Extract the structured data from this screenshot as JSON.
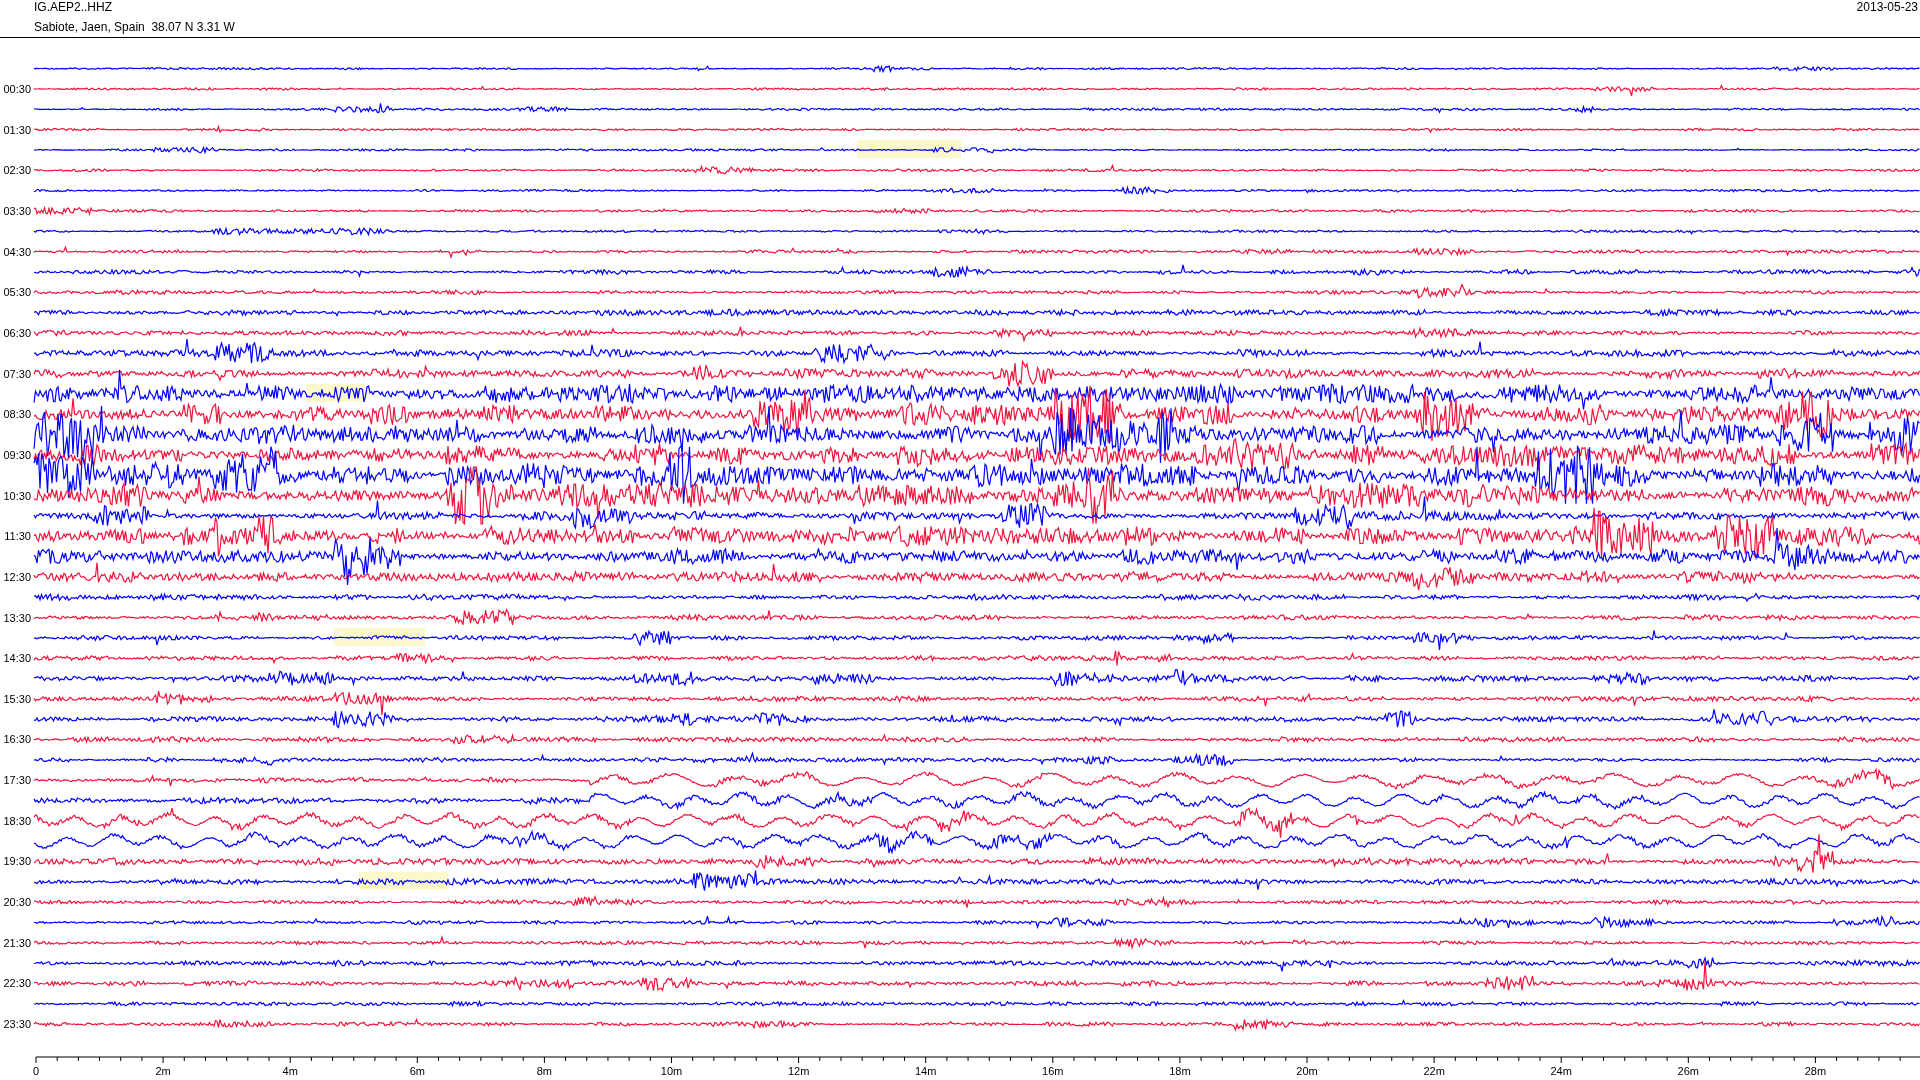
{
  "header": {
    "station": "IG.AEP2..HHZ",
    "location": "Sabiote, Jaen, Spain  38.07 N 3.31 W",
    "date": "2013-05-23"
  },
  "traces": [
    {
      "color": "#0000ff"
    },
    {
      "label": "00:30",
      "color": "#f0143c"
    },
    {
      "color": "#0000ff"
    },
    {
      "label": "01:30",
      "color": "#f0143c"
    },
    {
      "color": "#0000ff"
    },
    {
      "label": "02:30",
      "color": "#f0143c"
    },
    {
      "color": "#0000ff"
    },
    {
      "label": "03:30",
      "color": "#f0143c"
    },
    {
      "color": "#0000ff"
    },
    {
      "label": "04:30",
      "color": "#f0143c"
    },
    {
      "color": "#0000ff"
    },
    {
      "label": "05:30",
      "color": "#f0143c"
    },
    {
      "color": "#0000ff"
    },
    {
      "label": "06:30",
      "color": "#f0143c"
    },
    {
      "color": "#0000ff"
    },
    {
      "label": "07:30",
      "color": "#f0143c"
    },
    {
      "color": "#0000ff"
    },
    {
      "label": "08:30",
      "color": "#f0143c"
    },
    {
      "color": "#0000ff"
    },
    {
      "label": "09:30",
      "color": "#f0143c"
    },
    {
      "color": "#0000ff"
    },
    {
      "label": "10:30",
      "color": "#f0143c"
    },
    {
      "color": "#0000ff"
    },
    {
      "label": "11:30",
      "color": "#f0143c"
    },
    {
      "color": "#0000ff"
    },
    {
      "label": "12:30",
      "color": "#f0143c"
    },
    {
      "color": "#0000ff"
    },
    {
      "label": "13:30",
      "color": "#f0143c"
    },
    {
      "color": "#0000ff"
    },
    {
      "label": "14:30",
      "color": "#f0143c"
    },
    {
      "color": "#0000ff"
    },
    {
      "label": "15:30",
      "color": "#f0143c"
    },
    {
      "color": "#0000ff"
    },
    {
      "label": "16:30",
      "color": "#f0143c"
    },
    {
      "color": "#0000ff"
    },
    {
      "label": "17:30",
      "color": "#f0143c"
    },
    {
      "color": "#0000ff"
    },
    {
      "label": "18:30",
      "color": "#f0143c"
    },
    {
      "color": "#0000ff"
    },
    {
      "label": "19:30",
      "color": "#f0143c"
    },
    {
      "color": "#0000ff"
    },
    {
      "label": "20:30",
      "color": "#f0143c"
    },
    {
      "color": "#0000ff"
    },
    {
      "label": "21:30",
      "color": "#f0143c"
    },
    {
      "color": "#0000ff"
    },
    {
      "label": "22:30",
      "color": "#f0143c"
    },
    {
      "color": "#0000ff"
    },
    {
      "label": "23:30",
      "color": "#f0143c"
    }
  ],
  "axis": {
    "labels": [
      "0",
      "2m",
      "4m",
      "6m",
      "8m",
      "10m",
      "12m",
      "14m",
      "16m",
      "18m",
      "20m",
      "22m",
      "24m",
      "26m",
      "28m"
    ]
  }
}
